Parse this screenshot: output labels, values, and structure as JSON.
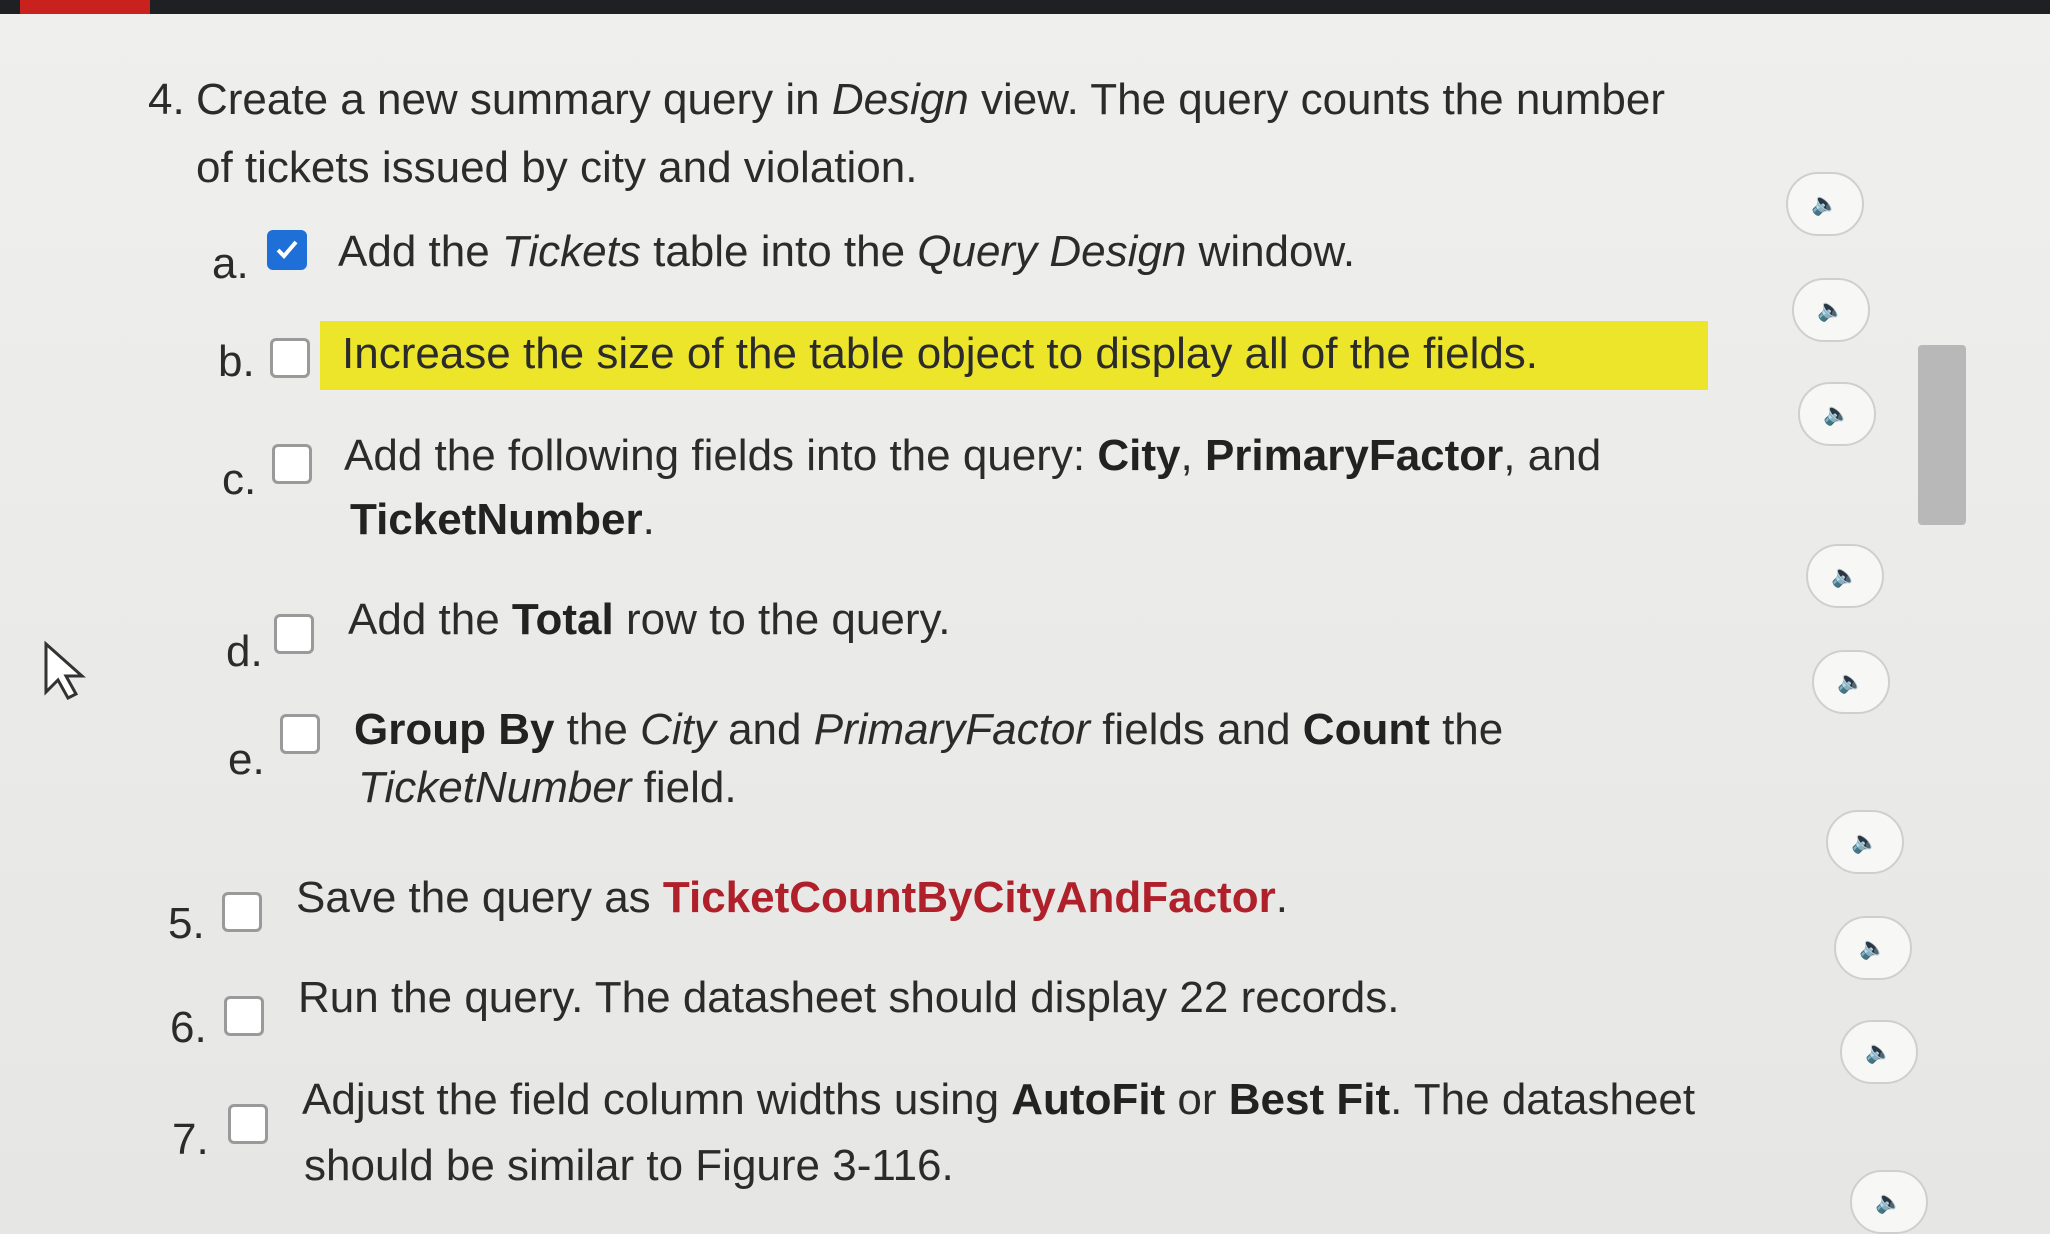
{
  "step4": {
    "number": "4.",
    "line1": "Create a new summary query in ",
    "line1_italic": "Design",
    "line1_end": " view. The query counts the number",
    "line2": "of tickets issued by city and violation."
  },
  "sub_a": {
    "letter": "a.",
    "p1": "Add the ",
    "i1": "Tickets",
    "p2": " table into the ",
    "i2": "Query Design",
    "p3": " window.",
    "checked": true
  },
  "sub_b": {
    "letter": "b.",
    "text": "Increase the size of the table object to display all of the fields.",
    "checked": false
  },
  "sub_c": {
    "letter": "c.",
    "p1": "Add the following fields into the query: ",
    "b1": "City",
    "p2": ", ",
    "b2": "PrimaryFactor",
    "p3": ", and",
    "b3": "TicketNumber",
    "p4": ".",
    "checked": false
  },
  "sub_d": {
    "letter": "d.",
    "p1": "Add the ",
    "b1": "Total",
    "p2": " row to the query.",
    "checked": false
  },
  "sub_e": {
    "letter": "e.",
    "b1": "Group By",
    "p1": " the ",
    "i1": "City",
    "p2": " and ",
    "i2": "PrimaryFactor",
    "p3": " fields and ",
    "b2": "Count",
    "p4": " the",
    "i3": "TicketNumber",
    "p5": " field.",
    "checked": false
  },
  "step5": {
    "number": "5.",
    "p1": "Save the query as ",
    "name": "TicketCountByCityAndFactor",
    "p2": ".",
    "checked": false
  },
  "step6": {
    "number": "6.",
    "text": "Run the query. The datasheet should display 22 records.",
    "checked": false
  },
  "step7": {
    "number": "7.",
    "p1": "Adjust the field column widths using ",
    "b1": "AutoFit",
    "p2": " or ",
    "b2": "Best Fit",
    "p3": ". The datasheet",
    "line2": "should be similar to Figure 3-116.",
    "checked": false
  },
  "speaker_glyph": "🔈",
  "colors": {
    "highlight": "#ece52a",
    "checkbox_checked": "#1f6fd9",
    "query_name": "#b0202a"
  }
}
